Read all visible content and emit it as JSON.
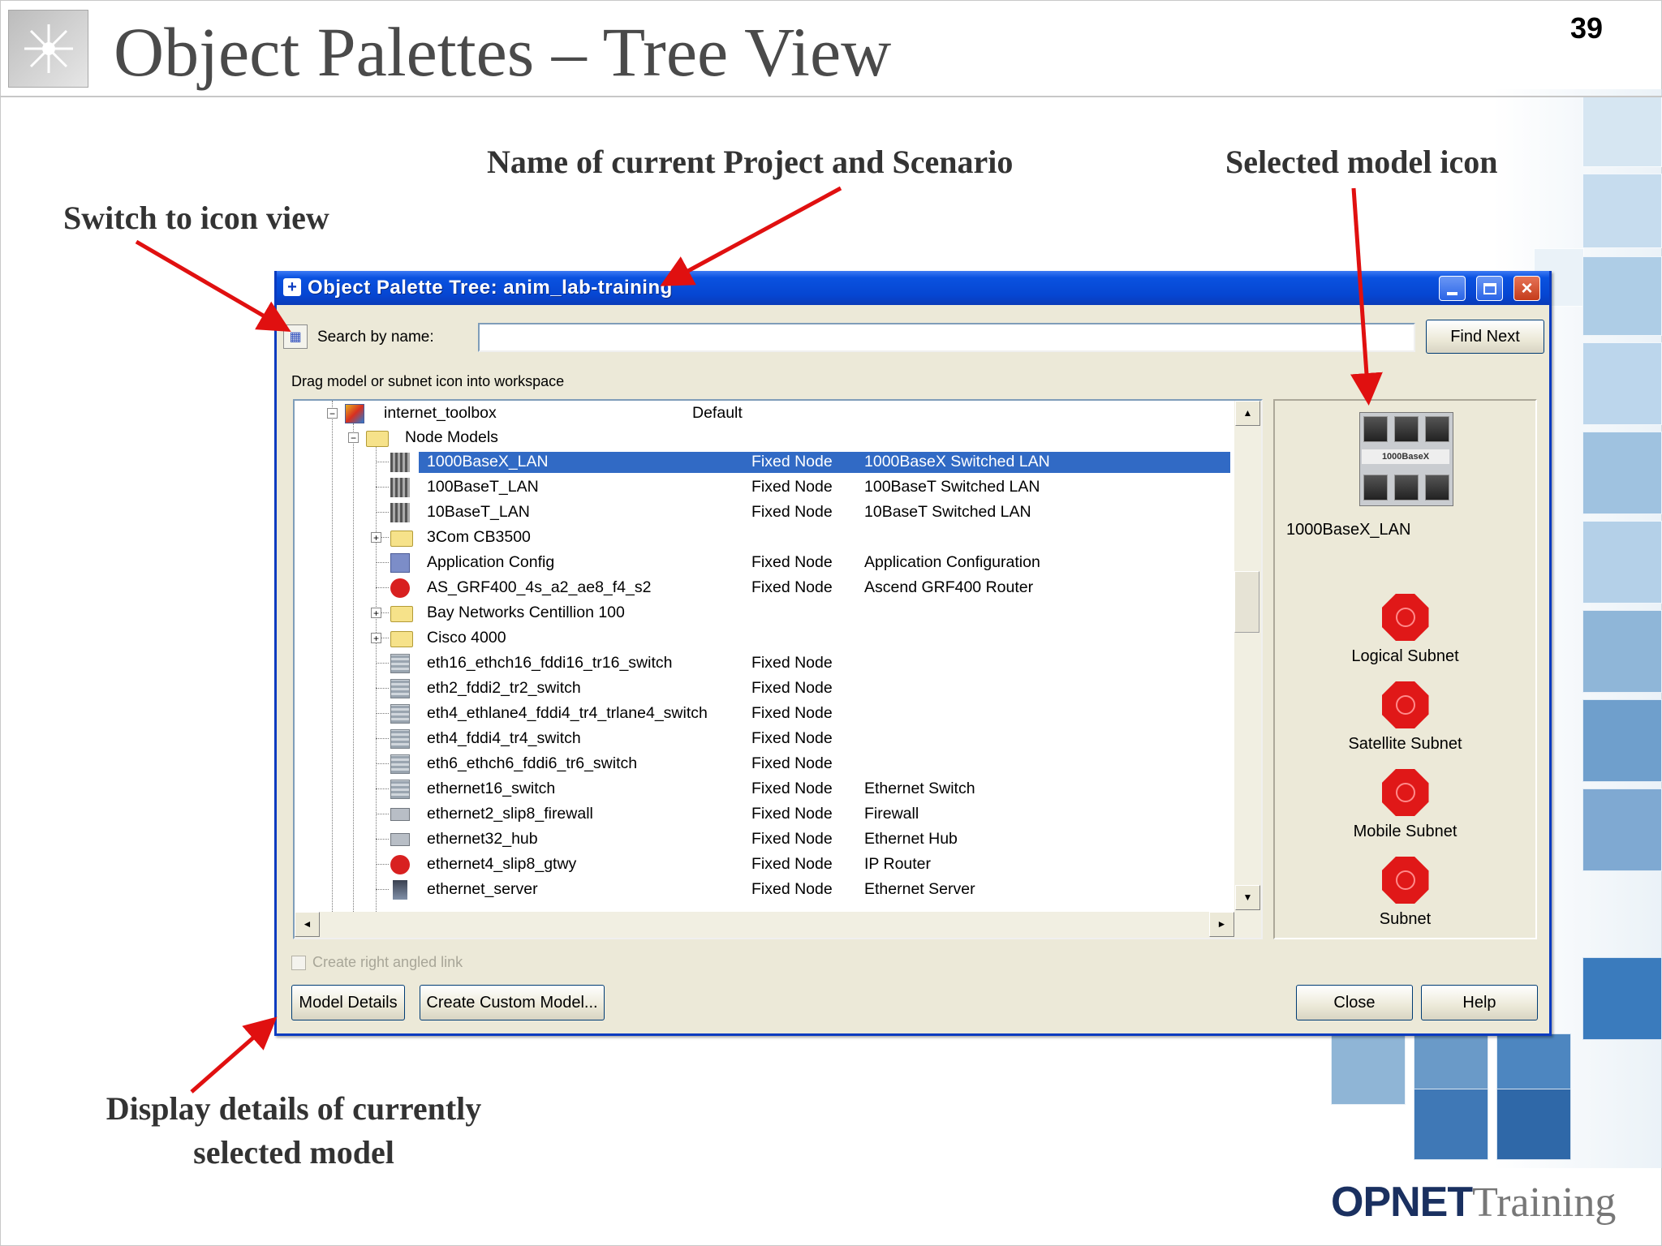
{
  "slide": {
    "title": "Object Palettes – Tree View",
    "page_number": "39",
    "brand_opnet": "OPNET",
    "brand_training": "Training"
  },
  "annotations": {
    "project_scenario": "Name of current Project and Scenario",
    "selected_icon": "Selected model icon",
    "switch_view": "Switch to icon view",
    "details_line1": "Display details of currently",
    "details_line2": "selected model"
  },
  "window": {
    "title": "Object Palette Tree: anim_lab-training",
    "search_label": "Search by name:",
    "search_value": "",
    "find_next": "Find Next",
    "hint": "Drag model or subnet icon into workspace",
    "checkbox_label": "Create right angled link",
    "buttons": {
      "model_details": "Model Details",
      "create_custom": "Create Custom Model...",
      "close": "Close",
      "help": "Help"
    }
  },
  "tree": {
    "root": {
      "name": "internet_toolbox",
      "type": "Default"
    },
    "group": "Node Models",
    "rows": [
      {
        "name": "1000BaseX_LAN",
        "type": "Fixed Node",
        "desc": "1000BaseX Switched LAN",
        "icon": "grid-icon",
        "selected": true
      },
      {
        "name": "100BaseT_LAN",
        "type": "Fixed Node",
        "desc": "100BaseT Switched LAN",
        "icon": "grid-icon"
      },
      {
        "name": "10BaseT_LAN",
        "type": "Fixed Node",
        "desc": "10BaseT Switched LAN",
        "icon": "grid-icon"
      },
      {
        "name": "3Com CB3500",
        "type": "",
        "desc": "",
        "icon": "folder-icon",
        "expandable": true
      },
      {
        "name": "Application Config",
        "type": "Fixed Node",
        "desc": "Application Configuration",
        "icon": "config-icon"
      },
      {
        "name": "AS_GRF400_4s_a2_ae8_f4_s2",
        "type": "Fixed Node",
        "desc": "Ascend GRF400 Router",
        "icon": "router-icon"
      },
      {
        "name": "Bay Networks Centillion 100",
        "type": "",
        "desc": "",
        "icon": "folder-icon",
        "expandable": true
      },
      {
        "name": "Cisco 4000",
        "type": "",
        "desc": "",
        "icon": "folder-icon",
        "expandable": true
      },
      {
        "name": "eth16_ethch16_fddi16_tr16_switch",
        "type": "Fixed Node",
        "desc": "",
        "icon": "switch-icon"
      },
      {
        "name": "eth2_fddi2_tr2_switch",
        "type": "Fixed Node",
        "desc": "",
        "icon": "switch-icon"
      },
      {
        "name": "eth4_ethlane4_fddi4_tr4_trlane4_switch",
        "type": "Fixed Node",
        "desc": "",
        "icon": "switch-icon"
      },
      {
        "name": "eth4_fddi4_tr4_switch",
        "type": "Fixed Node",
        "desc": "",
        "icon": "switch-icon"
      },
      {
        "name": "eth6_ethch6_fddi6_tr6_switch",
        "type": "Fixed Node",
        "desc": "",
        "icon": "switch-icon"
      },
      {
        "name": "ethernet16_switch",
        "type": "Fixed Node",
        "desc": "Ethernet Switch",
        "icon": "switch-icon"
      },
      {
        "name": "ethernet2_slip8_firewall",
        "type": "Fixed Node",
        "desc": "Firewall",
        "icon": "hub-icon"
      },
      {
        "name": "ethernet32_hub",
        "type": "Fixed Node",
        "desc": "Ethernet Hub",
        "icon": "hub-icon"
      },
      {
        "name": "ethernet4_slip8_gtwy",
        "type": "Fixed Node",
        "desc": "IP Router",
        "icon": "router-icon"
      },
      {
        "name": "ethernet_server",
        "type": "Fixed Node",
        "desc": "Ethernet Server",
        "icon": "server-icon"
      }
    ]
  },
  "right_panel": {
    "selected_model_name": "1000BaseX_LAN",
    "selected_model_icon_label": "1000BaseX",
    "subnets": [
      "Logical Subnet",
      "Satellite Subnet",
      "Mobile Subnet",
      "Subnet"
    ]
  },
  "colors": {
    "titlebar": "#0a52e0",
    "selection": "#316ac5",
    "arrow": "#e01010",
    "subnet": "#e01818"
  }
}
